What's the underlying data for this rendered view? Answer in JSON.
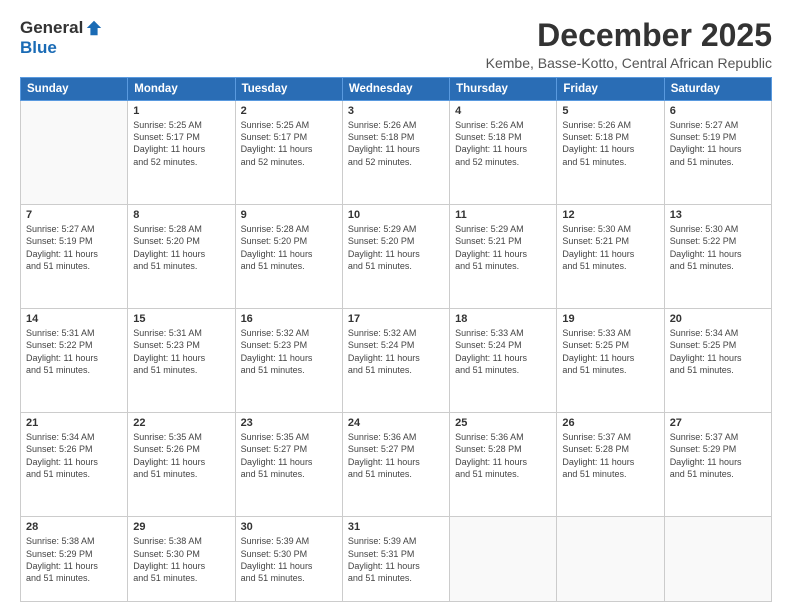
{
  "header": {
    "logo": {
      "general": "General",
      "blue": "Blue"
    },
    "title": "December 2025",
    "subtitle": "Kembe, Basse-Kotto, Central African Republic"
  },
  "weekdays": [
    "Sunday",
    "Monday",
    "Tuesday",
    "Wednesday",
    "Thursday",
    "Friday",
    "Saturday"
  ],
  "weeks": [
    [
      {
        "day": "",
        "info": ""
      },
      {
        "day": "1",
        "info": "Sunrise: 5:25 AM\nSunset: 5:17 PM\nDaylight: 11 hours\nand 52 minutes."
      },
      {
        "day": "2",
        "info": "Sunrise: 5:25 AM\nSunset: 5:17 PM\nDaylight: 11 hours\nand 52 minutes."
      },
      {
        "day": "3",
        "info": "Sunrise: 5:26 AM\nSunset: 5:18 PM\nDaylight: 11 hours\nand 52 minutes."
      },
      {
        "day": "4",
        "info": "Sunrise: 5:26 AM\nSunset: 5:18 PM\nDaylight: 11 hours\nand 52 minutes."
      },
      {
        "day": "5",
        "info": "Sunrise: 5:26 AM\nSunset: 5:18 PM\nDaylight: 11 hours\nand 51 minutes."
      },
      {
        "day": "6",
        "info": "Sunrise: 5:27 AM\nSunset: 5:19 PM\nDaylight: 11 hours\nand 51 minutes."
      }
    ],
    [
      {
        "day": "7",
        "info": "Sunrise: 5:27 AM\nSunset: 5:19 PM\nDaylight: 11 hours\nand 51 minutes."
      },
      {
        "day": "8",
        "info": "Sunrise: 5:28 AM\nSunset: 5:20 PM\nDaylight: 11 hours\nand 51 minutes."
      },
      {
        "day": "9",
        "info": "Sunrise: 5:28 AM\nSunset: 5:20 PM\nDaylight: 11 hours\nand 51 minutes."
      },
      {
        "day": "10",
        "info": "Sunrise: 5:29 AM\nSunset: 5:20 PM\nDaylight: 11 hours\nand 51 minutes."
      },
      {
        "day": "11",
        "info": "Sunrise: 5:29 AM\nSunset: 5:21 PM\nDaylight: 11 hours\nand 51 minutes."
      },
      {
        "day": "12",
        "info": "Sunrise: 5:30 AM\nSunset: 5:21 PM\nDaylight: 11 hours\nand 51 minutes."
      },
      {
        "day": "13",
        "info": "Sunrise: 5:30 AM\nSunset: 5:22 PM\nDaylight: 11 hours\nand 51 minutes."
      }
    ],
    [
      {
        "day": "14",
        "info": "Sunrise: 5:31 AM\nSunset: 5:22 PM\nDaylight: 11 hours\nand 51 minutes."
      },
      {
        "day": "15",
        "info": "Sunrise: 5:31 AM\nSunset: 5:23 PM\nDaylight: 11 hours\nand 51 minutes."
      },
      {
        "day": "16",
        "info": "Sunrise: 5:32 AM\nSunset: 5:23 PM\nDaylight: 11 hours\nand 51 minutes."
      },
      {
        "day": "17",
        "info": "Sunrise: 5:32 AM\nSunset: 5:24 PM\nDaylight: 11 hours\nand 51 minutes."
      },
      {
        "day": "18",
        "info": "Sunrise: 5:33 AM\nSunset: 5:24 PM\nDaylight: 11 hours\nand 51 minutes."
      },
      {
        "day": "19",
        "info": "Sunrise: 5:33 AM\nSunset: 5:25 PM\nDaylight: 11 hours\nand 51 minutes."
      },
      {
        "day": "20",
        "info": "Sunrise: 5:34 AM\nSunset: 5:25 PM\nDaylight: 11 hours\nand 51 minutes."
      }
    ],
    [
      {
        "day": "21",
        "info": "Sunrise: 5:34 AM\nSunset: 5:26 PM\nDaylight: 11 hours\nand 51 minutes."
      },
      {
        "day": "22",
        "info": "Sunrise: 5:35 AM\nSunset: 5:26 PM\nDaylight: 11 hours\nand 51 minutes."
      },
      {
        "day": "23",
        "info": "Sunrise: 5:35 AM\nSunset: 5:27 PM\nDaylight: 11 hours\nand 51 minutes."
      },
      {
        "day": "24",
        "info": "Sunrise: 5:36 AM\nSunset: 5:27 PM\nDaylight: 11 hours\nand 51 minutes."
      },
      {
        "day": "25",
        "info": "Sunrise: 5:36 AM\nSunset: 5:28 PM\nDaylight: 11 hours\nand 51 minutes."
      },
      {
        "day": "26",
        "info": "Sunrise: 5:37 AM\nSunset: 5:28 PM\nDaylight: 11 hours\nand 51 minutes."
      },
      {
        "day": "27",
        "info": "Sunrise: 5:37 AM\nSunset: 5:29 PM\nDaylight: 11 hours\nand 51 minutes."
      }
    ],
    [
      {
        "day": "28",
        "info": "Sunrise: 5:38 AM\nSunset: 5:29 PM\nDaylight: 11 hours\nand 51 minutes."
      },
      {
        "day": "29",
        "info": "Sunrise: 5:38 AM\nSunset: 5:30 PM\nDaylight: 11 hours\nand 51 minutes."
      },
      {
        "day": "30",
        "info": "Sunrise: 5:39 AM\nSunset: 5:30 PM\nDaylight: 11 hours\nand 51 minutes."
      },
      {
        "day": "31",
        "info": "Sunrise: 5:39 AM\nSunset: 5:31 PM\nDaylight: 11 hours\nand 51 minutes."
      },
      {
        "day": "",
        "info": ""
      },
      {
        "day": "",
        "info": ""
      },
      {
        "day": "",
        "info": ""
      }
    ]
  ]
}
